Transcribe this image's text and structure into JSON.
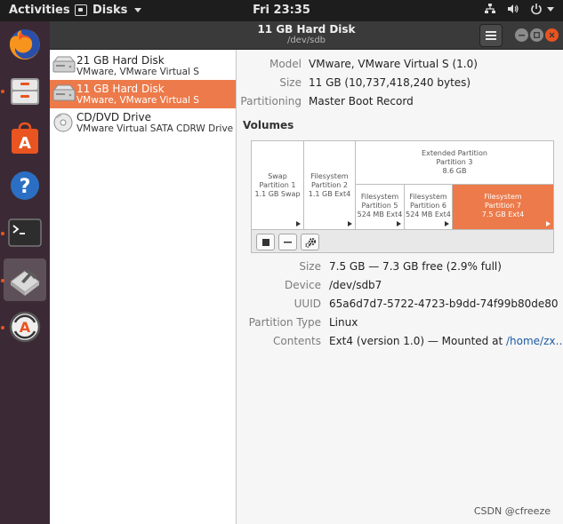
{
  "topbar": {
    "activities": "Activities",
    "app_name": "Disks",
    "clock": "Fri 23:35"
  },
  "header": {
    "title": "11 GB Hard Disk",
    "subtitle": "/dev/sdb"
  },
  "disks": [
    {
      "name": "21 GB Hard Disk",
      "model": "VMware, VMware Virtual S",
      "icon": "hard-disk-icon",
      "selected": false
    },
    {
      "name": "11 GB Hard Disk",
      "model": "VMware, VMware Virtual S",
      "icon": "hard-disk-icon",
      "selected": true
    },
    {
      "name": "CD/DVD Drive",
      "model": "VMware Virtual SATA CDRW Drive",
      "icon": "optical-disc-icon",
      "selected": false
    }
  ],
  "drive_info": {
    "model_label": "Model",
    "model_value": "VMware, VMware Virtual S (1.0)",
    "size_label": "Size",
    "size_value": "11 GB (10,737,418,240 bytes)",
    "partitioning_label": "Partitioning",
    "partitioning_value": "Master Boot Record"
  },
  "volumes_heading": "Volumes",
  "volumes": {
    "swap": {
      "line1": "Swap",
      "line2": "Partition 1",
      "line3": "1.1 GB Swap"
    },
    "fs2": {
      "line1": "Filesystem",
      "line2": "Partition 2",
      "line3": "1.1 GB Ext4"
    },
    "extended": {
      "line1": "Extended Partition",
      "line2": "Partition 3",
      "line3": "8.6 GB"
    },
    "fs5": {
      "line1": "Filesystem",
      "line2": "Partition 5",
      "line3": "524 MB Ext4"
    },
    "fs6": {
      "line1": "Filesystem",
      "line2": "Partition 6",
      "line3": "524 MB Ext4"
    },
    "fs7": {
      "line1": "Filesystem",
      "line2": "Partition 7",
      "line3": "7.5 GB Ext4"
    }
  },
  "partition_info": {
    "size_label": "Size",
    "size_value": "7.5 GB — 7.3 GB free (2.9% full)",
    "device_label": "Device",
    "device_value": "/dev/sdb7",
    "uuid_label": "UUID",
    "uuid_value": "65a6d7d7-5722-4723-b9dd-74f99b80de80",
    "ptype_label": "Partition Type",
    "ptype_value": "Linux",
    "contents_label": "Contents",
    "contents_value": "Ext4 (version 1.0) — Mounted at ",
    "mount_link": "/home/zx…"
  },
  "watermark": "CSDN @cfreeze",
  "colors": {
    "accent": "#e95420",
    "selection": "#ec7a4a",
    "dock": "#3b2a35",
    "topbar": "#1d1d1d"
  }
}
